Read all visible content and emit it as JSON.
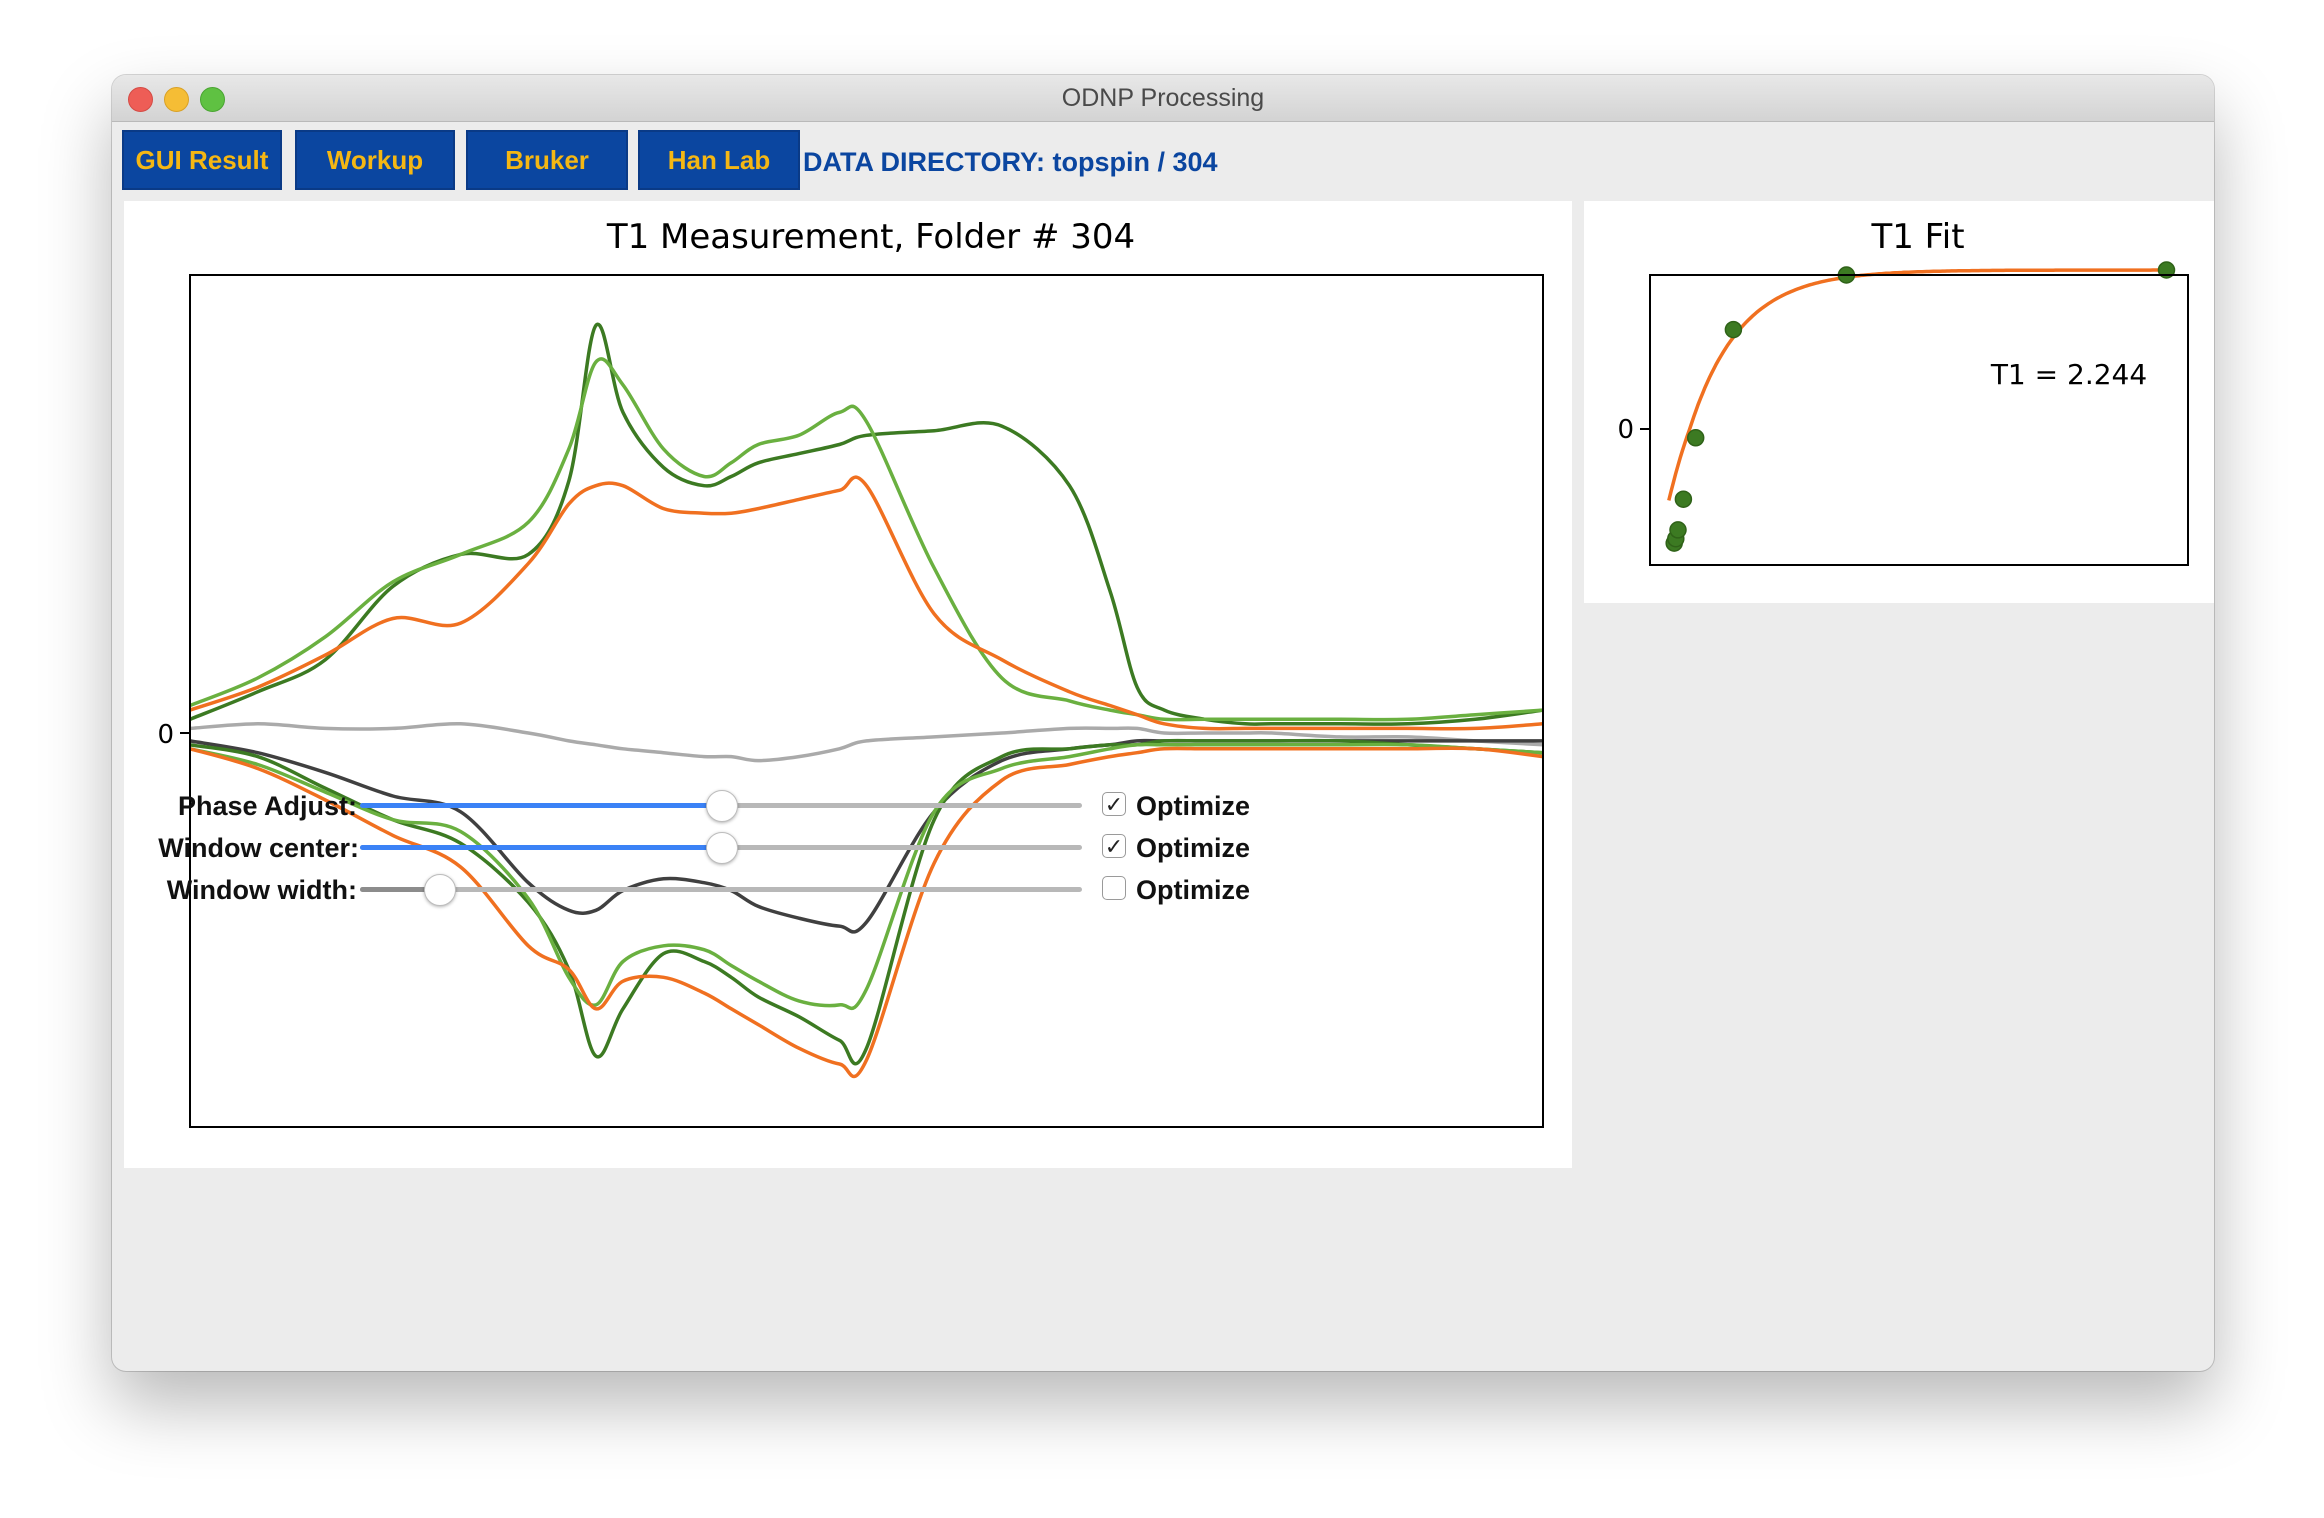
{
  "window": {
    "title": "ODNP Processing"
  },
  "toolbar": {
    "buttons": [
      {
        "label": "GUI Result"
      },
      {
        "label": "Workup"
      },
      {
        "label": "Bruker"
      },
      {
        "label": "Han Lab"
      }
    ],
    "data_directory": "DATA DIRECTORY: topspin / 304"
  },
  "controls": [
    {
      "label": "Phase Adjust:",
      "value": 0.5,
      "optimize_label": "Optimize",
      "optimize_checked": true
    },
    {
      "label": "Window center:",
      "value": 0.5,
      "optimize_label": "Optimize",
      "optimize_checked": true
    },
    {
      "label": "Window width:",
      "value": 0.11,
      "optimize_label": "Optimize",
      "optimize_checked": false
    }
  ],
  "colors": {
    "button_bg": "#0b46a0",
    "button_text": "#f5b713",
    "slider_active": "#3b82f6",
    "slider_inactive": "#8c8c8c",
    "orange": "#f07020",
    "green_dark": "#3c7a22",
    "green_light": "#6ab040",
    "gray_dark": "#404040",
    "gray_light": "#aaaaaa"
  },
  "chart_data": [
    {
      "type": "line",
      "title": "T1 Measurement, Folder # 304",
      "xlabel": "",
      "ylabel": "",
      "ylim": [
        -1,
        1
      ],
      "y_ticks": [
        0
      ],
      "y_tick_labels": [
        "0"
      ],
      "grid": false,
      "x": [
        0,
        0.05,
        0.1,
        0.15,
        0.2,
        0.25,
        0.28,
        0.3,
        0.32,
        0.35,
        0.38,
        0.4,
        0.42,
        0.45,
        0.48,
        0.5,
        0.55,
        0.6,
        0.65,
        0.68,
        0.7,
        0.72,
        0.75,
        0.78,
        0.8,
        0.85,
        0.9,
        0.95,
        1.0
      ],
      "series": [
        {
          "color": "#3c7a22",
          "values": [
            0.03,
            0.09,
            0.16,
            0.32,
            0.39,
            0.39,
            0.55,
            0.89,
            0.7,
            0.58,
            0.54,
            0.56,
            0.59,
            0.61,
            0.63,
            0.65,
            0.66,
            0.67,
            0.54,
            0.31,
            0.1,
            0.05,
            0.03,
            0.02,
            0.02,
            0.02,
            0.02,
            0.03,
            0.05
          ]
        },
        {
          "color": "#6ab040",
          "values": [
            0.06,
            0.12,
            0.21,
            0.33,
            0.39,
            0.46,
            0.62,
            0.81,
            0.76,
            0.62,
            0.56,
            0.59,
            0.63,
            0.65,
            0.7,
            0.68,
            0.36,
            0.12,
            0.07,
            0.05,
            0.04,
            0.03,
            0.03,
            0.03,
            0.03,
            0.03,
            0.03,
            0.04,
            0.05
          ]
        },
        {
          "color": "#f07020",
          "values": [
            0.05,
            0.1,
            0.17,
            0.25,
            0.24,
            0.37,
            0.5,
            0.54,
            0.54,
            0.49,
            0.48,
            0.48,
            0.49,
            0.51,
            0.53,
            0.54,
            0.26,
            0.16,
            0.09,
            0.06,
            0.04,
            0.02,
            0.01,
            0.01,
            0.01,
            0.01,
            0.01,
            0.01,
            0.02
          ]
        },
        {
          "color": "#aaaaaa",
          "values": [
            0.01,
            0.02,
            0.01,
            0.01,
            0.02,
            0.0,
            -0.02,
            -0.03,
            -0.04,
            -0.05,
            -0.06,
            -0.06,
            -0.07,
            -0.06,
            -0.04,
            -0.02,
            -0.01,
            0.0,
            0.01,
            0.01,
            0.01,
            0.0,
            0.0,
            0.0,
            0.0,
            -0.01,
            -0.01,
            -0.02,
            -0.03
          ]
        },
        {
          "color": "#404040",
          "values": [
            -0.02,
            -0.05,
            -0.1,
            -0.16,
            -0.2,
            -0.38,
            -0.45,
            -0.45,
            -0.4,
            -0.37,
            -0.38,
            -0.4,
            -0.44,
            -0.47,
            -0.49,
            -0.48,
            -0.2,
            -0.07,
            -0.04,
            -0.03,
            -0.02,
            -0.02,
            -0.02,
            -0.02,
            -0.02,
            -0.02,
            -0.02,
            -0.02,
            -0.02
          ]
        },
        {
          "color": "#3c7a22",
          "values": [
            -0.03,
            -0.06,
            -0.14,
            -0.22,
            -0.28,
            -0.43,
            -0.6,
            -0.82,
            -0.7,
            -0.56,
            -0.58,
            -0.62,
            -0.67,
            -0.72,
            -0.78,
            -0.8,
            -0.22,
            -0.06,
            -0.04,
            -0.03,
            -0.03,
            -0.02,
            -0.02,
            -0.02,
            -0.02,
            -0.02,
            -0.03,
            -0.04,
            -0.05
          ]
        },
        {
          "color": "#6ab040",
          "values": [
            -0.04,
            -0.08,
            -0.15,
            -0.22,
            -0.25,
            -0.42,
            -0.62,
            -0.69,
            -0.58,
            -0.54,
            -0.55,
            -0.59,
            -0.63,
            -0.68,
            -0.69,
            -0.65,
            -0.2,
            -0.09,
            -0.06,
            -0.04,
            -0.03,
            -0.03,
            -0.03,
            -0.03,
            -0.03,
            -0.03,
            -0.03,
            -0.04,
            -0.05
          ]
        },
        {
          "color": "#f07020",
          "values": [
            -0.04,
            -0.09,
            -0.17,
            -0.26,
            -0.34,
            -0.54,
            -0.6,
            -0.7,
            -0.63,
            -0.62,
            -0.66,
            -0.7,
            -0.74,
            -0.8,
            -0.84,
            -0.83,
            -0.33,
            -0.12,
            -0.08,
            -0.06,
            -0.05,
            -0.04,
            -0.04,
            -0.04,
            -0.04,
            -0.04,
            -0.04,
            -0.04,
            -0.06
          ]
        }
      ]
    },
    {
      "type": "scatter",
      "title": "T1 Fit",
      "xlabel": "",
      "ylabel": "",
      "y_ticks": [
        0
      ],
      "y_tick_labels": [
        "0"
      ],
      "xlim": [
        0,
        10
      ],
      "ylim": [
        -1.55,
        1.55
      ],
      "grid": false,
      "annotation": "T1 = 2.244",
      "points": {
        "x": [
          0.45,
          0.48,
          0.52,
          0.62,
          0.85,
          1.55,
          3.65,
          9.6
        ],
        "y": [
          -1.3,
          -1.25,
          -1.15,
          -0.8,
          -0.1,
          1.0,
          1.55,
          1.6
        ]
      },
      "fit": {
        "model": "exponential recovery",
        "T1": 2.244,
        "plateau": 1.6,
        "start": -1.9
      }
    }
  ]
}
